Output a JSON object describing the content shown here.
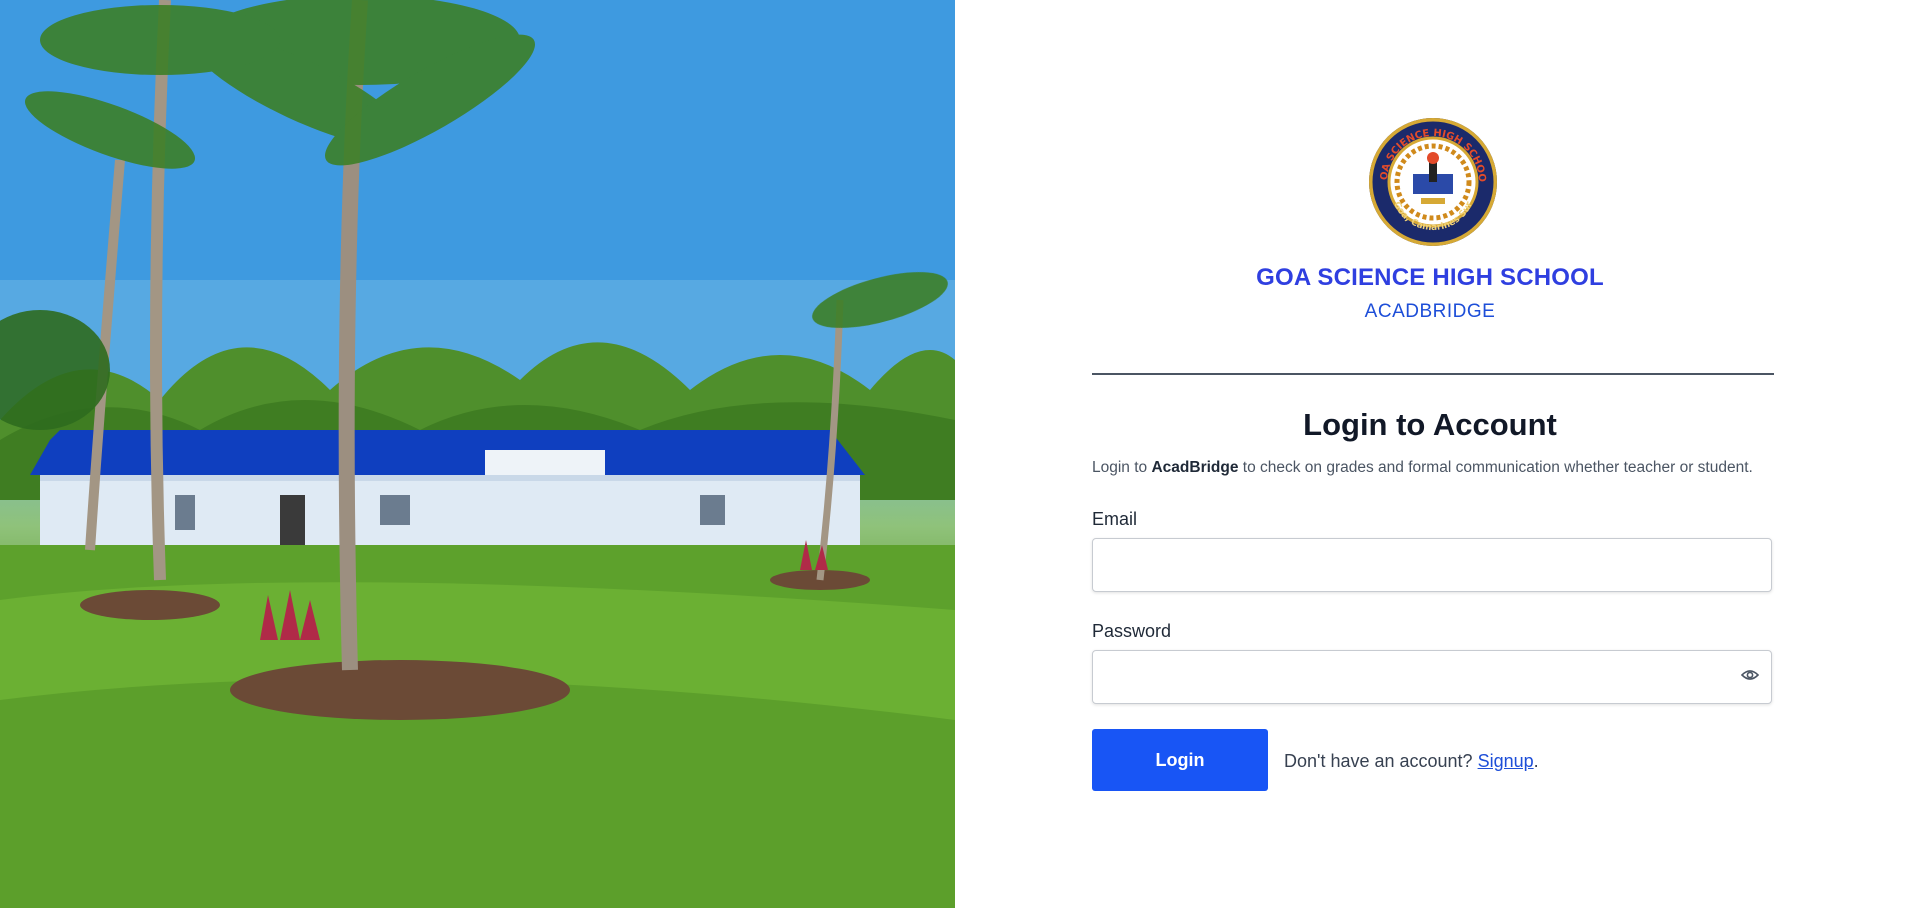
{
  "branding": {
    "school_name": "GOA SCIENCE HIGH SCHOOL",
    "app_name": "ACADBRIDGE",
    "logo_text_top": "GOA SCIENCE HIGH SCHOOL",
    "logo_text_bottom": "Goa, Camarines Sur"
  },
  "login": {
    "heading": "Login to Account",
    "subtext_prefix": "Login to ",
    "subtext_brand": "AcadBridge",
    "subtext_suffix": " to check on grades and formal communication whether teacher or student.",
    "email_label": "Email",
    "email_value": "",
    "password_label": "Password",
    "password_value": "",
    "login_button": "Login",
    "signup_prompt": "Don't have an account? ",
    "signup_link": "Signup",
    "signup_period": "."
  },
  "icons": {
    "password_toggle": "eye-icon"
  },
  "colors": {
    "primary_button": "#1855f5",
    "school_name": "#2f3fe0",
    "app_name": "#1d4ed8"
  }
}
